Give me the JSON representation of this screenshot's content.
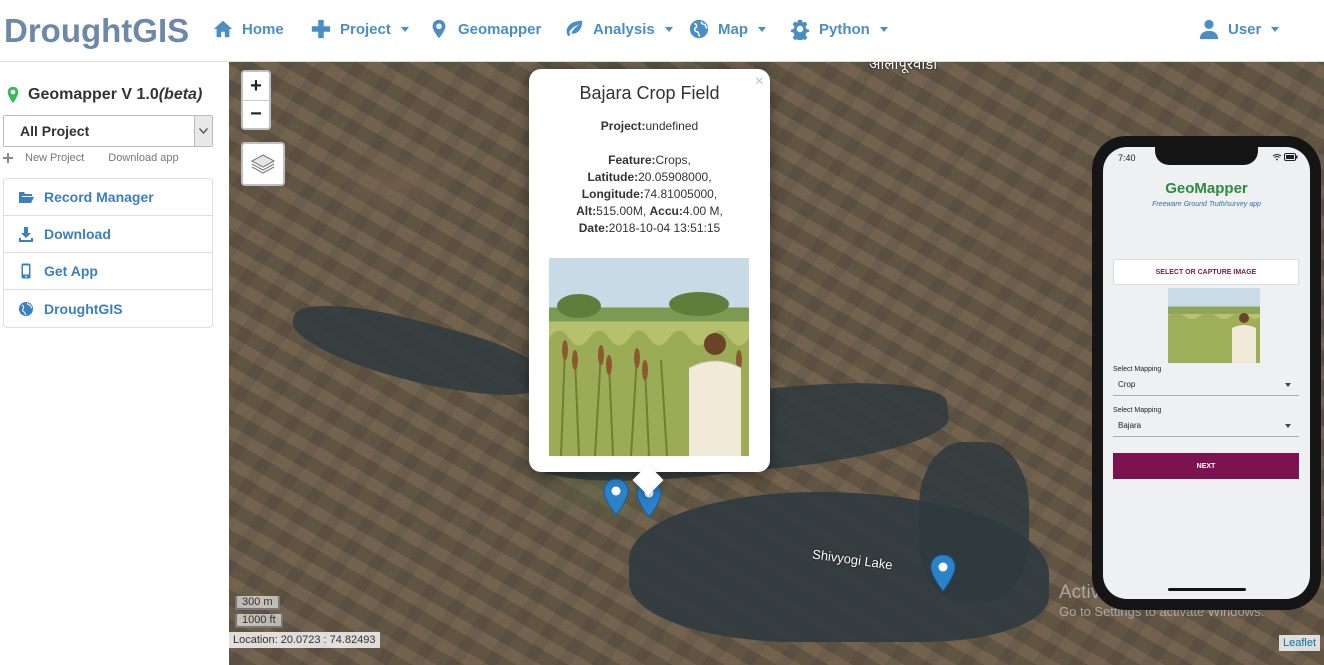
{
  "brand": "DroughtGIS",
  "colors": {
    "brand": "#6d88a8",
    "nav_link": "#4a8ec5",
    "marker": "#2b82cb",
    "app_accent": "#7d1250",
    "app_title": "#2c8b3f"
  },
  "nav": {
    "home": {
      "label": "Home",
      "icon": "home-icon"
    },
    "project": {
      "label": "Project",
      "icon": "plus-icon"
    },
    "geomapper": {
      "label": "Geomapper",
      "icon": "map-pin-icon"
    },
    "analysis": {
      "label": "Analysis",
      "icon": "leaf-icon"
    },
    "map": {
      "label": "Map",
      "icon": "globe-icon"
    },
    "python": {
      "label": "Python",
      "icon": "gear-icon"
    },
    "user": {
      "label": "User",
      "icon": "user-icon"
    }
  },
  "sidebar": {
    "title": "Geomapper V 1.0",
    "title_suffix": "(beta)",
    "project_select": "All Project",
    "new_project": "New Project",
    "download_app": "Download app",
    "items": [
      {
        "label": "Record Manager",
        "icon": "folder-open-icon"
      },
      {
        "label": "Download",
        "icon": "download-icon"
      },
      {
        "label": "Get App",
        "icon": "mobile-icon"
      },
      {
        "label": "DroughtGIS",
        "icon": "globe-icon"
      }
    ]
  },
  "map": {
    "zoom_in": "+",
    "zoom_out": "−",
    "village_label": "आलापूरवाडी",
    "lake_label": "Shivyogi Lake",
    "scale_m": "300 m",
    "scale_ft": "1000 ft",
    "location": "Location: 20.0723 : 74.82493",
    "attribution": "Leaflet",
    "watermark_title": "Activate Windows",
    "watermark_sub": "Go to Settings to activate Windows."
  },
  "popup": {
    "close": "×",
    "title": "Bajara Crop Field",
    "project_label": "Project:",
    "project_value": "undefined",
    "feature_label": "Feature:",
    "feature_value": "Crops,",
    "lat_label": "Latitude:",
    "lat_value": "20.05908000,",
    "lon_label": "Longitude:",
    "lon_value": "74.81005000,",
    "alt_label": "Alt:",
    "alt_value": "515.00M, ",
    "accu_label": "Accu:",
    "accu_value": "4.00 M,",
    "date_label": "Date:",
    "date_value": "2018-10-04 13:51:15"
  },
  "phone": {
    "time": "7:40",
    "app_title": "GeoMapper",
    "app_subtitle": "Freeware Ground Truth/survey app",
    "capture_button": "SELECT OR CAPTURE IMAGE",
    "mapping1_label": "Select Mapping",
    "mapping1_value": "Crop",
    "mapping2_label": "Select Mapping",
    "mapping2_value": "Bajara",
    "next_button": "NEXT"
  }
}
